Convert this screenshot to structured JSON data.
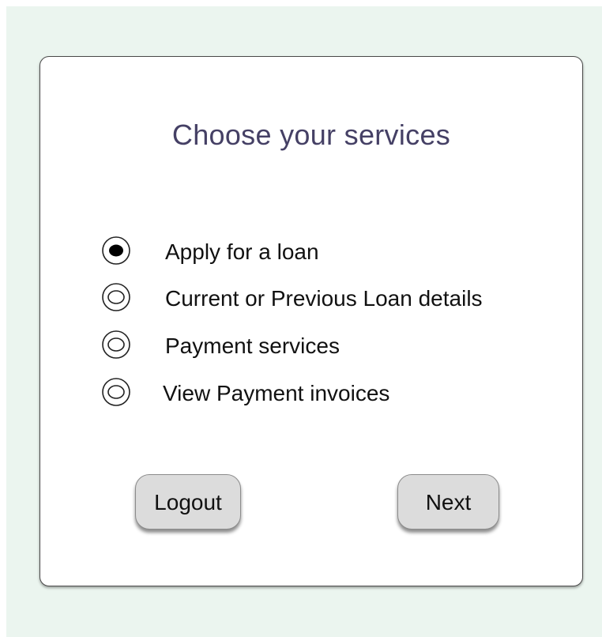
{
  "card": {
    "title": "Choose your services"
  },
  "services": {
    "options": [
      {
        "label": "Apply for a loan",
        "selected": true
      },
      {
        "label": "Current or Previous Loan details",
        "selected": false
      },
      {
        "label": "Payment services",
        "selected": false
      },
      {
        "label": "View Payment invoices",
        "selected": false
      }
    ]
  },
  "actions": {
    "logout_label": "Logout",
    "next_label": "Next"
  },
  "colors": {
    "background": "#ebf5ef",
    "title": "#454065",
    "button": "#dcdcdc"
  }
}
